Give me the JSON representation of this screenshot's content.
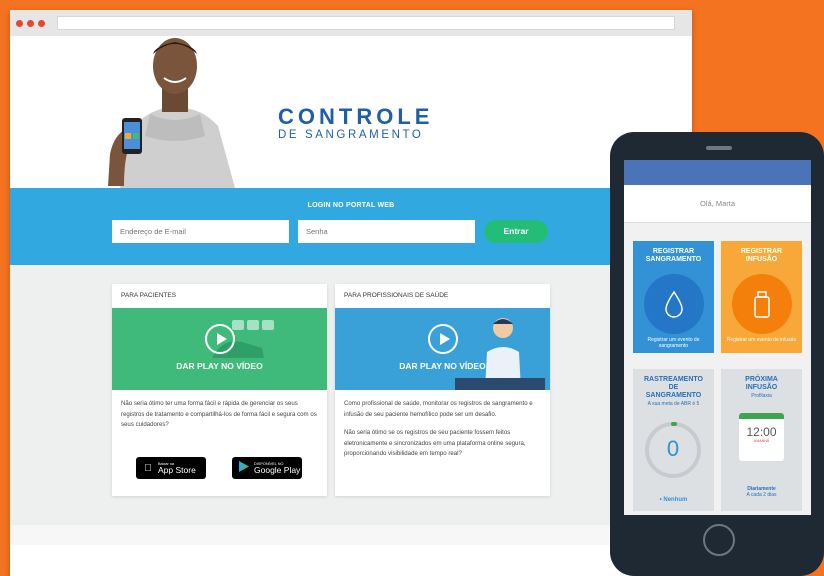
{
  "logo": {
    "main": "CONTROLE",
    "sub": "DE SANGRAMENTO"
  },
  "login": {
    "title": "LOGIN NO PORTAL WEB",
    "email_placeholder": "Endereço de E-mail",
    "password_placeholder": "Senha",
    "submit_label": "Entrar"
  },
  "cards": {
    "patients": {
      "title": "PARA PACIENTES",
      "video_label": "DAR PLAY NO VÍDEO",
      "text": "Não seria ótimo ter uma forma fácil e rápida de gerenciar os seus registros de tratamento e compartilhá-los de forma fácil e segura com os seus cuidadores?"
    },
    "professionals": {
      "title": "PARA PROFISSIONAIS DE SAÚDE",
      "video_label": "DAR PLAY NO VÍDEO",
      "text1": "Como profissional de saúde, monitorar os registros de sangramento e infusão de seu paciente hemofílico pode ser um desafio.",
      "text2": "Não seria ótimo se os registros de seu paciente fossem feitos eletronicamente e sincronizados em uma plataforma online segura, proporcionando visibilidade em tempo real?"
    }
  },
  "stores": {
    "apple_small": "Baixar na",
    "apple_big": "App Store",
    "google_small": "DISPONÍVEL NO",
    "google_big": "Google Play"
  },
  "phone": {
    "greeting": "Olá, Marta",
    "tile_bleed": {
      "title_l1": "REGISTRAR",
      "title_l2": "SANGRAMENTO",
      "foot": "Registrar um evento de sangramento"
    },
    "tile_infusion": {
      "title_l1": "REGISTRAR",
      "title_l2": "INFUSÃO",
      "foot": "Registrar um evento de infusão"
    },
    "tile_tracking": {
      "title_l1": "RASTREAMENTO",
      "title_l2": "DE",
      "title_l3": "SANGRAMENTO",
      "sub": "A sua meta de ABR é 5",
      "value": "0",
      "status": "• Nenhum"
    },
    "tile_next": {
      "title_l1": "PRÓXIMA",
      "title_l2": "INFUSÃO",
      "sub": "Profilaxia",
      "time": "12:00",
      "day": "AMANHÃ",
      "freq": "Diariamente",
      "interval": "A cada 2 dias"
    }
  },
  "colors": {
    "background": "#f47320",
    "primary_blue": "#31a8e0",
    "enter_green": "#23bd77",
    "brand_blue": "#1f5ea8"
  }
}
